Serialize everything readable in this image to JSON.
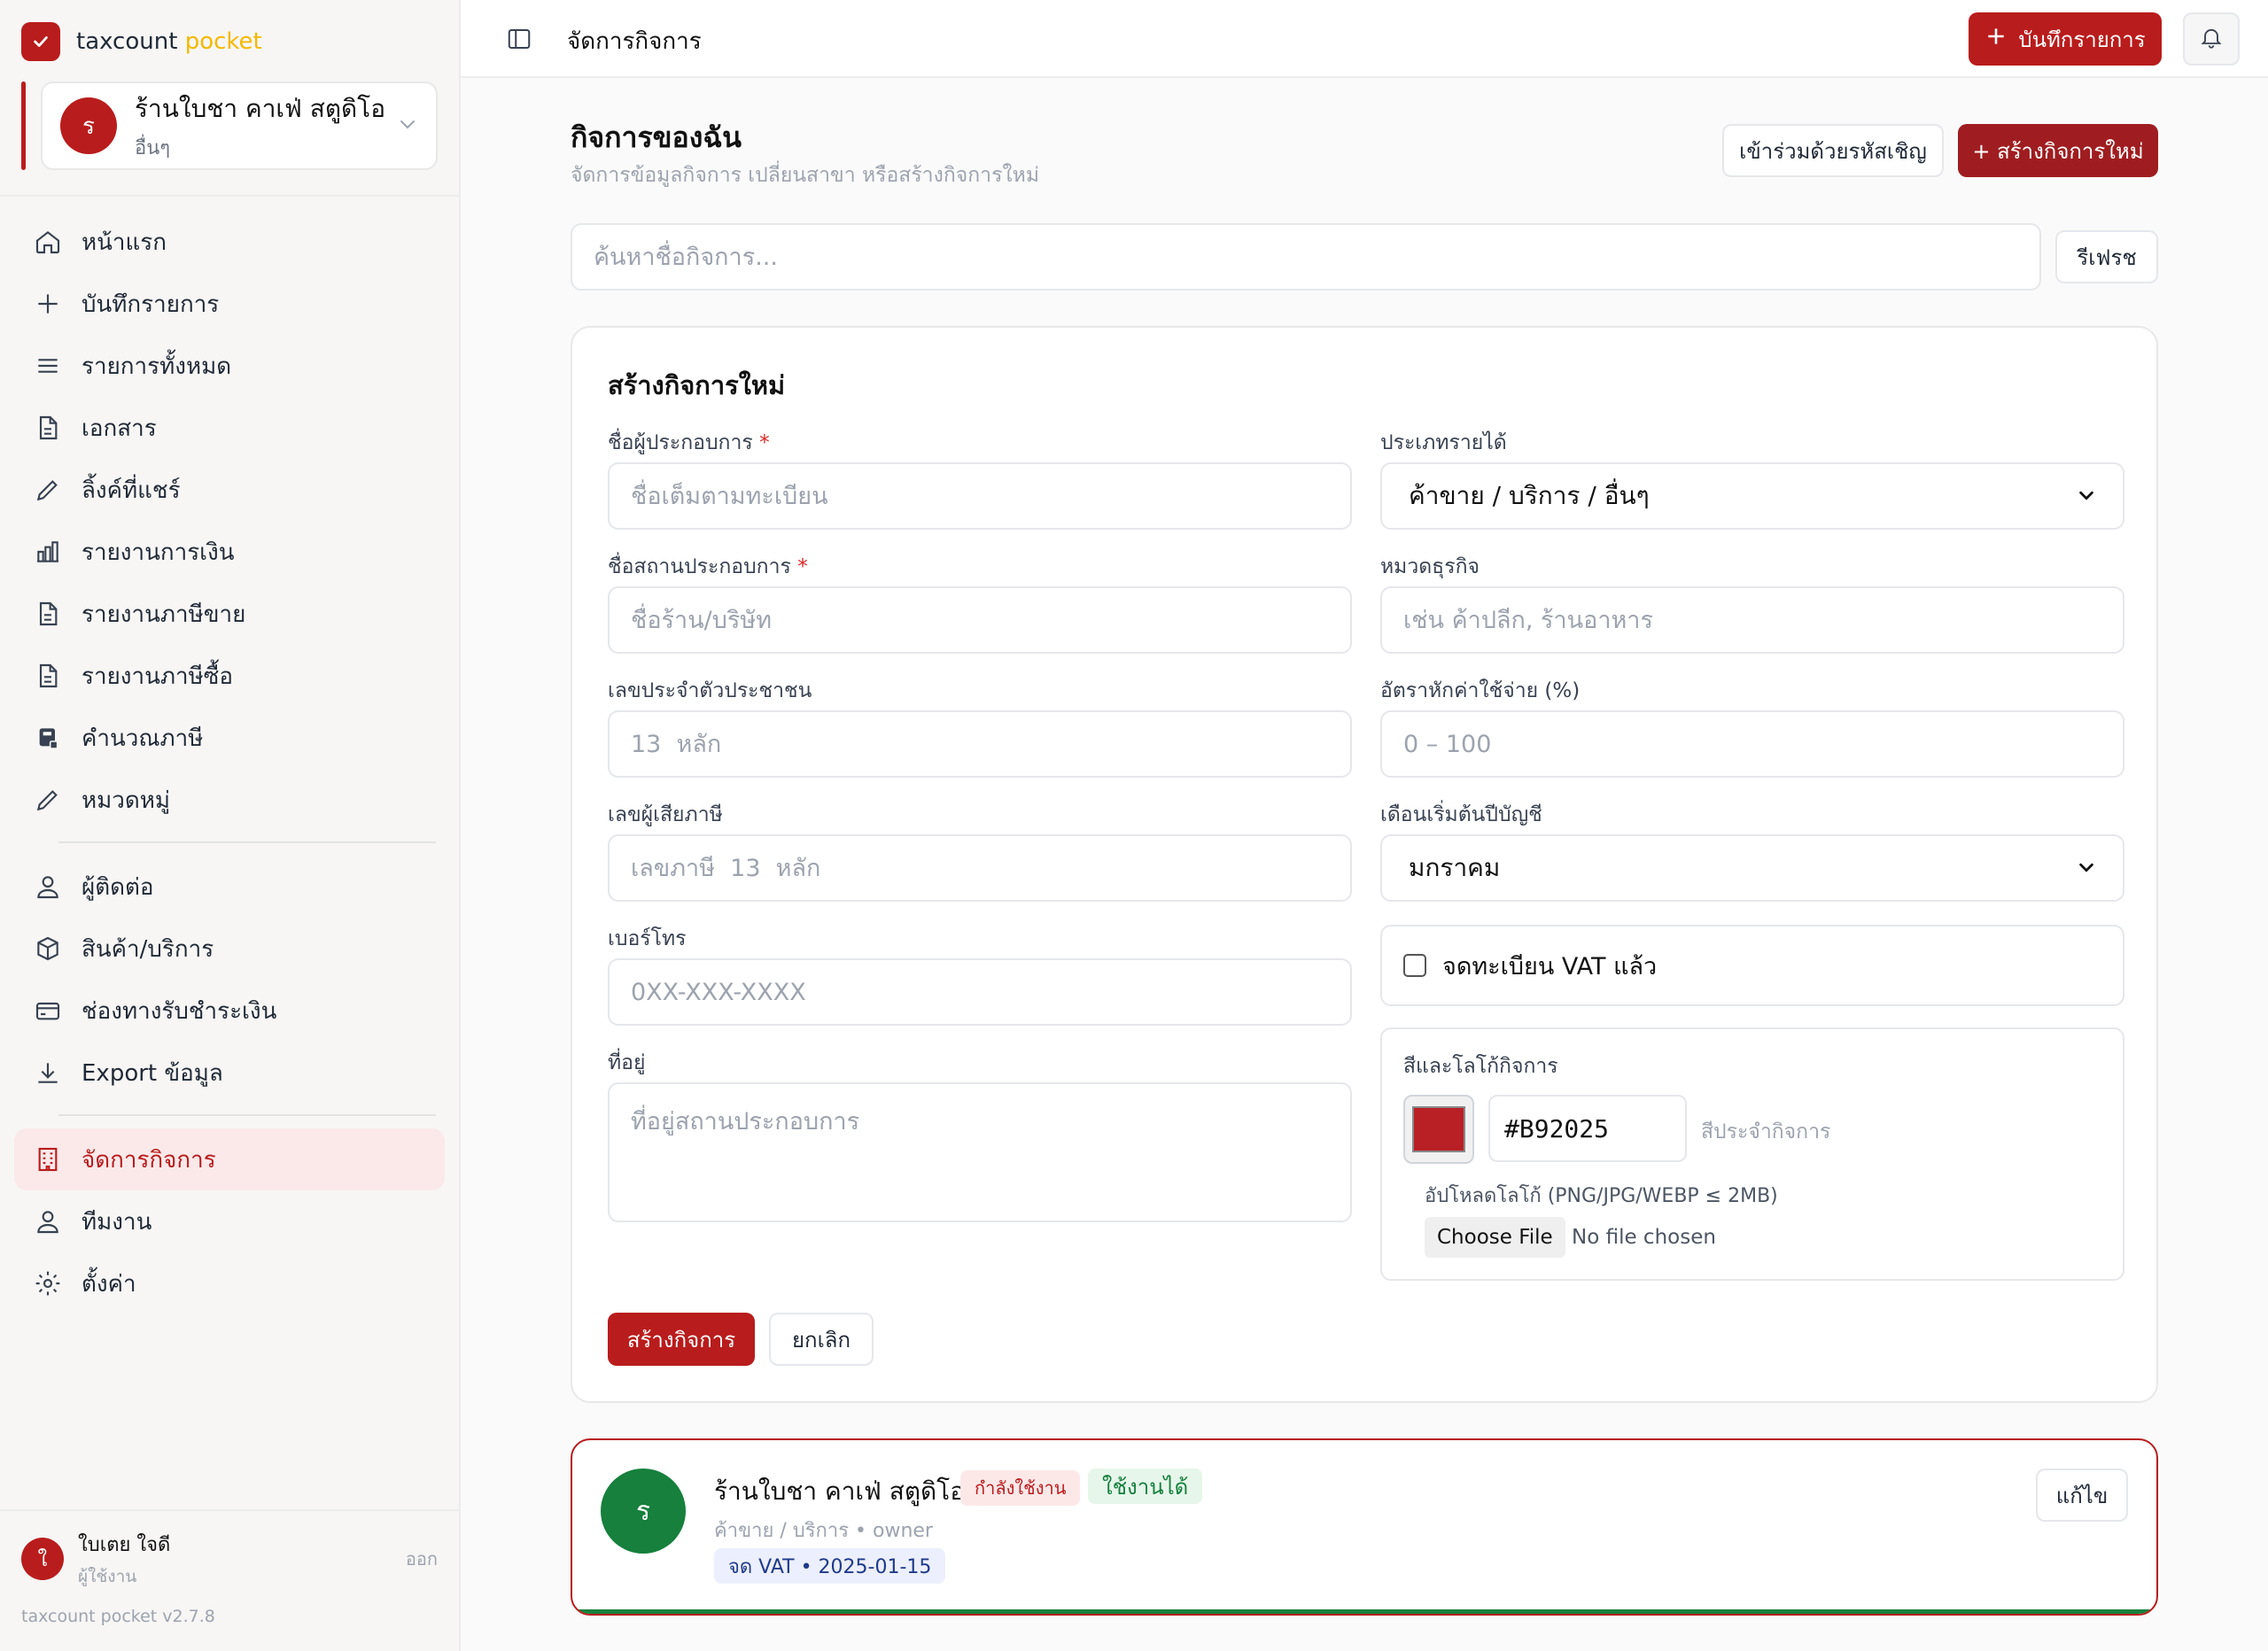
{
  "brand": {
    "name": "taxcount",
    "accent": "pocket",
    "color": "#B91C1C"
  },
  "switcher": {
    "initial": "ร",
    "name": "ร้านใบชา คาเฟ่ สตูดิโอ",
    "type": "อื่นๆ"
  },
  "nav": {
    "home": "หน้าแรก",
    "record": "บันทึกรายการ",
    "all": "รายการทั้งหมด",
    "documents": "เอกสาร",
    "shared_links": "ลิ้งค์ที่แชร์",
    "finance_report": "รายงานการเงิน",
    "sales_tax_report": "รายงานภาษีขาย",
    "purchase_tax_report": "รายงานภาษีซื้อ",
    "tax_calc": "คำนวณภาษี",
    "categories": "หมวดหมู่",
    "contacts": "ผู้ติดต่อ",
    "products": "สินค้า/บริการ",
    "payment_channels": "ช่องทางรับชำระเงิน",
    "export": "Export ข้อมูล",
    "manage_business": "จัดการกิจการ",
    "team": "ทีมงาน",
    "settings": "ตั้งค่า"
  },
  "user": {
    "initial": "ใ",
    "name": "ใบเตย ใจดี",
    "role": "ผู้ใช้งาน",
    "logout": "ออก"
  },
  "version": "taxcount pocket v2.7.8",
  "topbar": {
    "title": "จัดการกิจการ",
    "record_button": "บันทึกรายการ"
  },
  "page": {
    "title": "กิจการของฉัน",
    "subtitle": "จัดการข้อมูลกิจการ เปลี่ยนสาขา หรือสร้างกิจการใหม่",
    "join_button": "เข้าร่วมด้วยรหัสเชิญ",
    "create_button": "+ สร้างกิจการใหม่",
    "search_placeholder": "ค้นหาชื่อกิจการ...",
    "refresh_button": "รีเฟรช"
  },
  "form": {
    "title": "สร้างกิจการใหม่",
    "owner_label": "ชื่อผู้ประกอบการ",
    "owner_placeholder": "ชื่อเต็มตามทะเบียน",
    "shop_label": "ชื่อสถานประกอบการ",
    "shop_placeholder": "ชื่อร้าน/บริษัท",
    "id_label": "เลขประจำตัวประชาชน",
    "id_placeholder": "13  หลัก",
    "taxid_label": "เลขผู้เสียภาษี",
    "taxid_placeholder": "เลขภาษี  13  หลัก",
    "phone_label": "เบอร์โทร",
    "phone_placeholder": "0XX-XXX-XXXX",
    "address_label": "ที่อยู่",
    "address_placeholder": "ที่อยู่สถานประกอบการ",
    "income_type_label": "ประเภทรายได้",
    "income_type_value": "ค้าขาย / บริการ / อื่นๆ",
    "category_label": "หมวดธุรกิจ",
    "category_placeholder": "เช่น ค้าปลีก, ร้านอาหาร",
    "expense_rate_label": "อัตราหักค่าใช้จ่าย (%)",
    "expense_rate_placeholder": "0 – 100",
    "fiscal_start_label": "เดือนเริ่มต้นปีบัญชี",
    "fiscal_start_value": "มกราคม",
    "vat_label": "จดทะเบียน VAT แล้ว",
    "vat_checked": false,
    "brand_label": "สีและโลโก้กิจการ",
    "color_value": "#B92025",
    "color_note": "สีประจำกิจการ",
    "upload_label": "อัปโหลดโลโก้ (PNG/JPG/WEBP ≤ 2MB)",
    "choose_file": "Choose File",
    "no_file": "No file chosen",
    "submit": "สร้างกิจการ",
    "cancel": "ยกเลิก"
  },
  "business_item": {
    "initial": "ร",
    "name": "ร้านใบชา คาเฟ่ สตูดิโอ",
    "active_badge": "กำลังใช้งาน",
    "status_badge": "ใช้งานได้",
    "meta": "ค้าขาย / บริการ • owner",
    "vat_badge": "จด VAT • 2025-01-15",
    "edit_button": "แก้ไข",
    "color": "#16803C"
  }
}
